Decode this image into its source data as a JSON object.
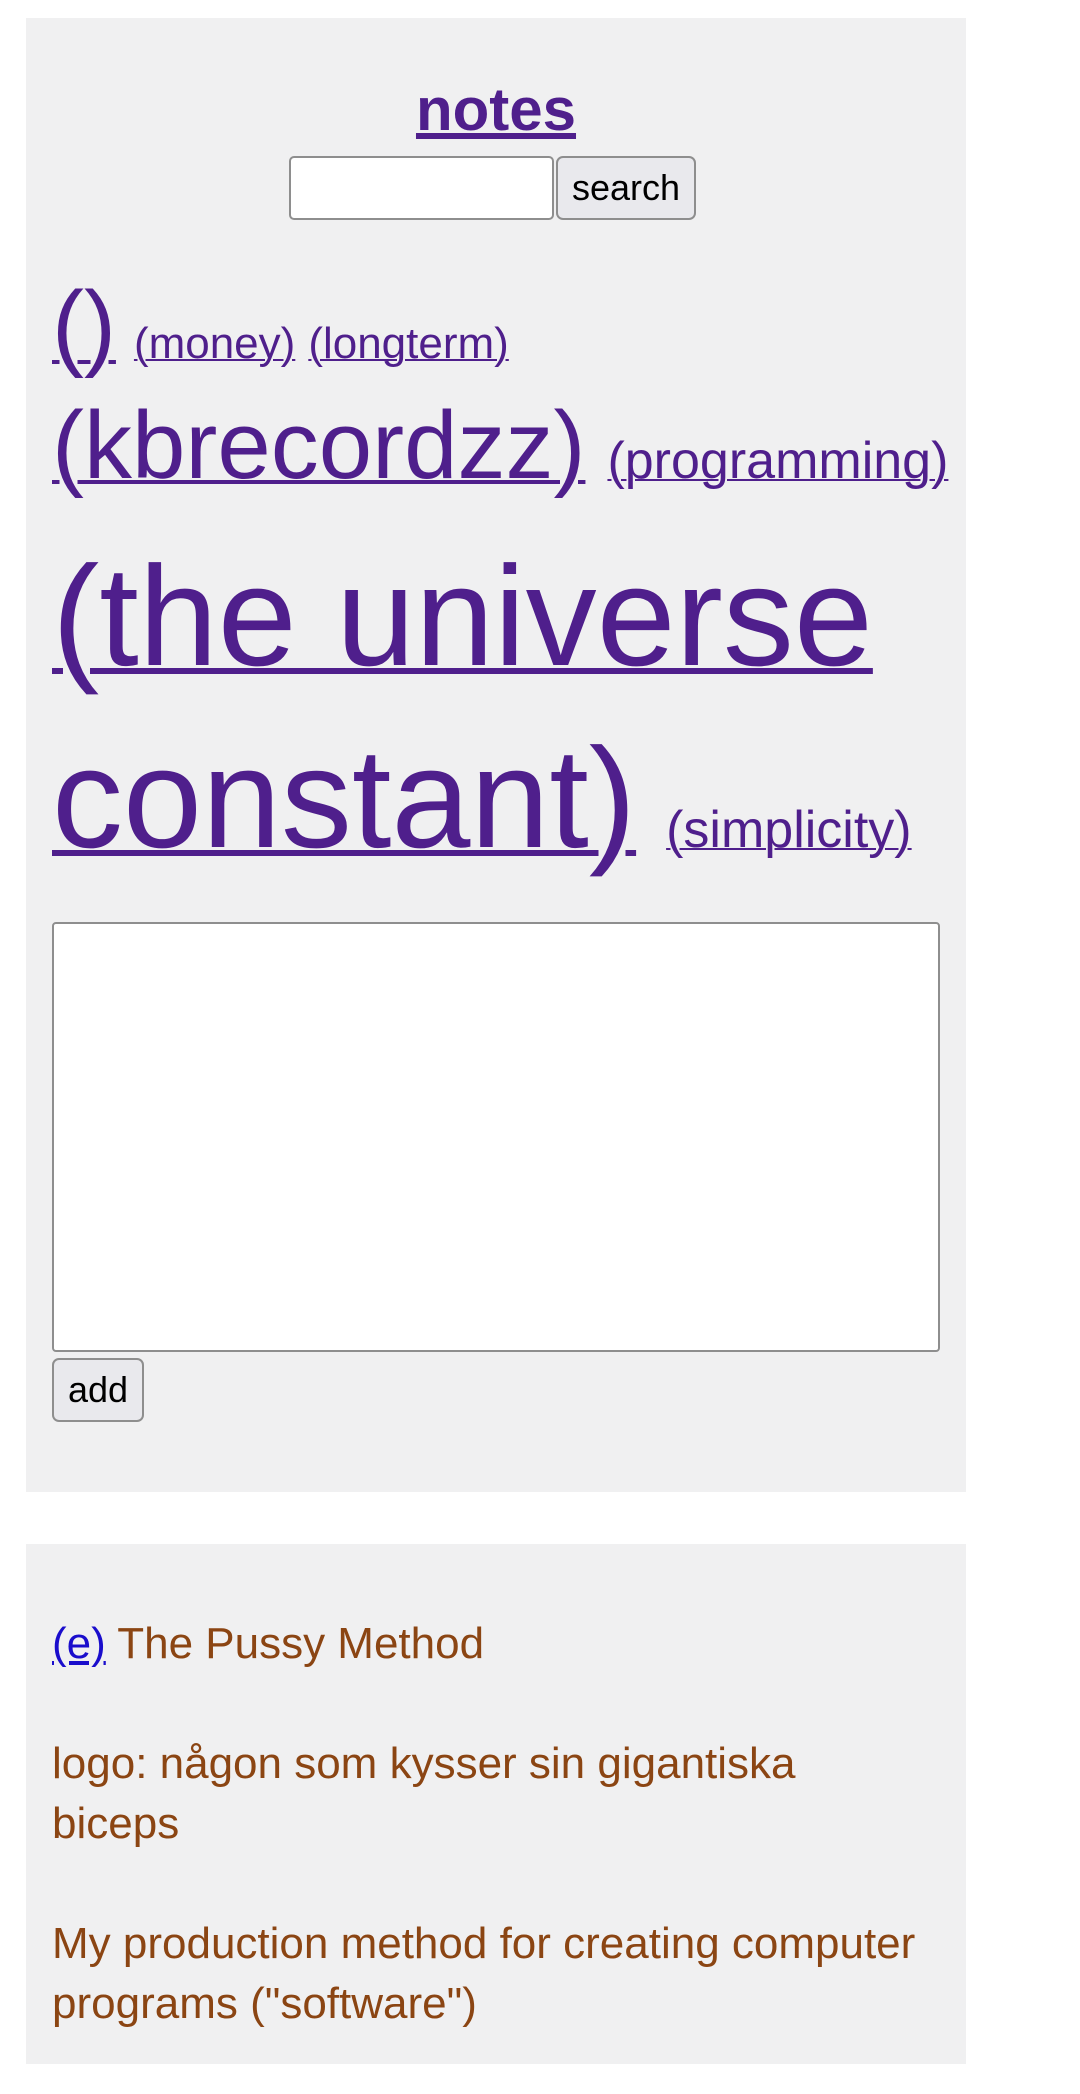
{
  "header": {
    "title": "notes"
  },
  "search": {
    "value": "",
    "placeholder": "",
    "button_label": "search"
  },
  "tags": [
    {
      "label": "()"
    },
    {
      "label": "(money)"
    },
    {
      "label": "(longterm)"
    },
    {
      "label": "(kbrecordzz)"
    },
    {
      "label": "(programming)"
    },
    {
      "label": "(the universe constant)"
    },
    {
      "label": "(simplicity)"
    }
  ],
  "composer": {
    "value": "",
    "add_label": "add"
  },
  "note": {
    "edit_label": "(e)",
    "title": "The Pussy Method",
    "paragraphs": [
      "logo: någon som kysser sin gigantiska biceps",
      "My production method for creating computer programs (\"software\")"
    ]
  },
  "colors": {
    "link": "#4f1f8c",
    "note_text": "#8b4513",
    "edit_link": "#1a0dcc",
    "panel_bg": "#f0f0f1"
  }
}
